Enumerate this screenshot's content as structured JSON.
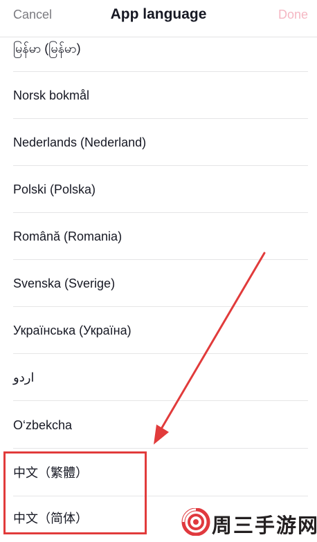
{
  "header": {
    "cancel_label": "Cancel",
    "title": "App language",
    "done_label": "Done"
  },
  "languages": [
    "မြန်မာ (မြန်မာ)",
    "Norsk bokmål",
    "Nederlands (Nederland)",
    "Polski (Polska)",
    "Română (Romania)",
    "Svenska (Sverige)",
    "Українська (Україна)",
    "اردو",
    "O‘zbekcha",
    "中文（繁體）",
    "中文（简体）"
  ],
  "watermark": {
    "text": "周三手游网"
  },
  "colors": {
    "annotation": "#e13b3b",
    "done_disabled": "#f5b7c3",
    "cancel": "#7b7b80"
  }
}
